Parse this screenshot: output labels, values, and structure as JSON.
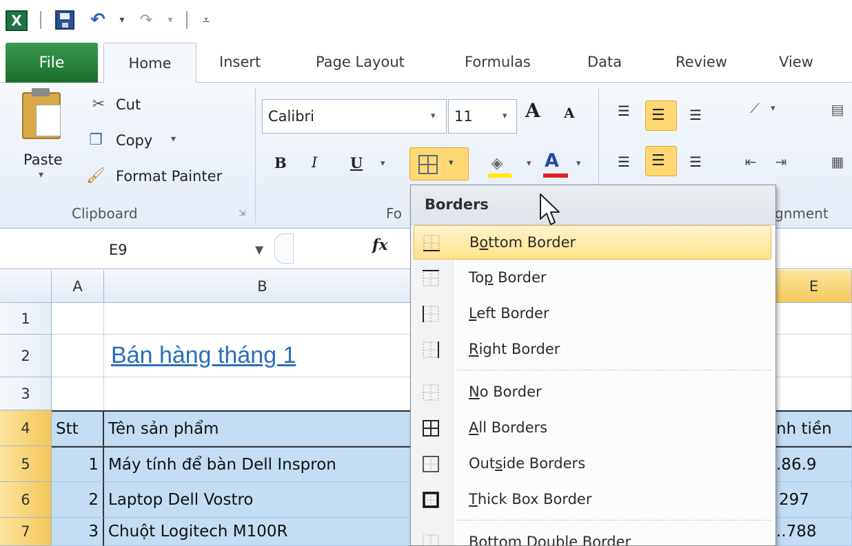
{
  "app": {
    "name": "Excel"
  },
  "tabs": [
    {
      "label": "File"
    },
    {
      "label": "Home"
    },
    {
      "label": "Insert"
    },
    {
      "label": "Page Layout"
    },
    {
      "label": "Formulas"
    },
    {
      "label": "Data"
    },
    {
      "label": "Review"
    },
    {
      "label": "View"
    }
  ],
  "clipboard": {
    "paste_label": "Paste",
    "cut_label": "Cut",
    "copy_label": "Copy",
    "format_painter_label": "Format Painter",
    "group_label": "Clipboard"
  },
  "font": {
    "name": "Calibri",
    "size": "11",
    "group_label_partial": "Fo",
    "bold": "B",
    "italic": "I",
    "underline": "U",
    "font_color_glyph": "A",
    "grow": "A",
    "shrink": "A"
  },
  "alignment": {
    "group_label_partial": "gnment"
  },
  "formula_bar": {
    "name_box": "E9",
    "fx": "fx"
  },
  "grid": {
    "columns": [
      "A",
      "B",
      "E"
    ],
    "rows": [
      "1",
      "2",
      "3",
      "4",
      "5",
      "6",
      "7"
    ],
    "title": "Bán hàng tháng 1",
    "header": {
      "stt": "Stt",
      "product": "Tên sản phẩm",
      "amount": "nh tiền"
    },
    "data_rows": [
      {
        "stt": "1",
        "product": "Máy tính để bàn Dell Inspron",
        "amount": ".86.9"
      },
      {
        "stt": "2",
        "product": "Laptop Dell Vostro",
        "amount": "297"
      },
      {
        "stt": "3",
        "product": "Chuột Logitech M100R",
        "amount": "..788"
      }
    ]
  },
  "borders_menu": {
    "title": "Borders",
    "items": [
      {
        "pre": "B",
        "ul": "o",
        "post": "ttom Border",
        "icon": "bottom-border-icon"
      },
      {
        "pre": "To",
        "ul": "p",
        "post": " Border",
        "icon": "top-border-icon"
      },
      {
        "pre": "",
        "ul": "L",
        "post": "eft Border",
        "icon": "left-border-icon"
      },
      {
        "pre": "",
        "ul": "R",
        "post": "ight Border",
        "icon": "right-border-icon"
      },
      {
        "pre": "",
        "ul": "N",
        "post": "o Border",
        "icon": "no-border-icon"
      },
      {
        "pre": "",
        "ul": "A",
        "post": "ll Borders",
        "icon": "all-borders-icon"
      },
      {
        "pre": "Out",
        "ul": "s",
        "post": "ide Borders",
        "icon": "outside-borders-icon"
      },
      {
        "pre": "",
        "ul": "T",
        "post": "hick Box Border",
        "icon": "thick-box-border-icon"
      },
      {
        "pre": "Bottom Double Border",
        "ul": "",
        "post": "",
        "icon": "bottom-double-border-icon"
      }
    ]
  }
}
